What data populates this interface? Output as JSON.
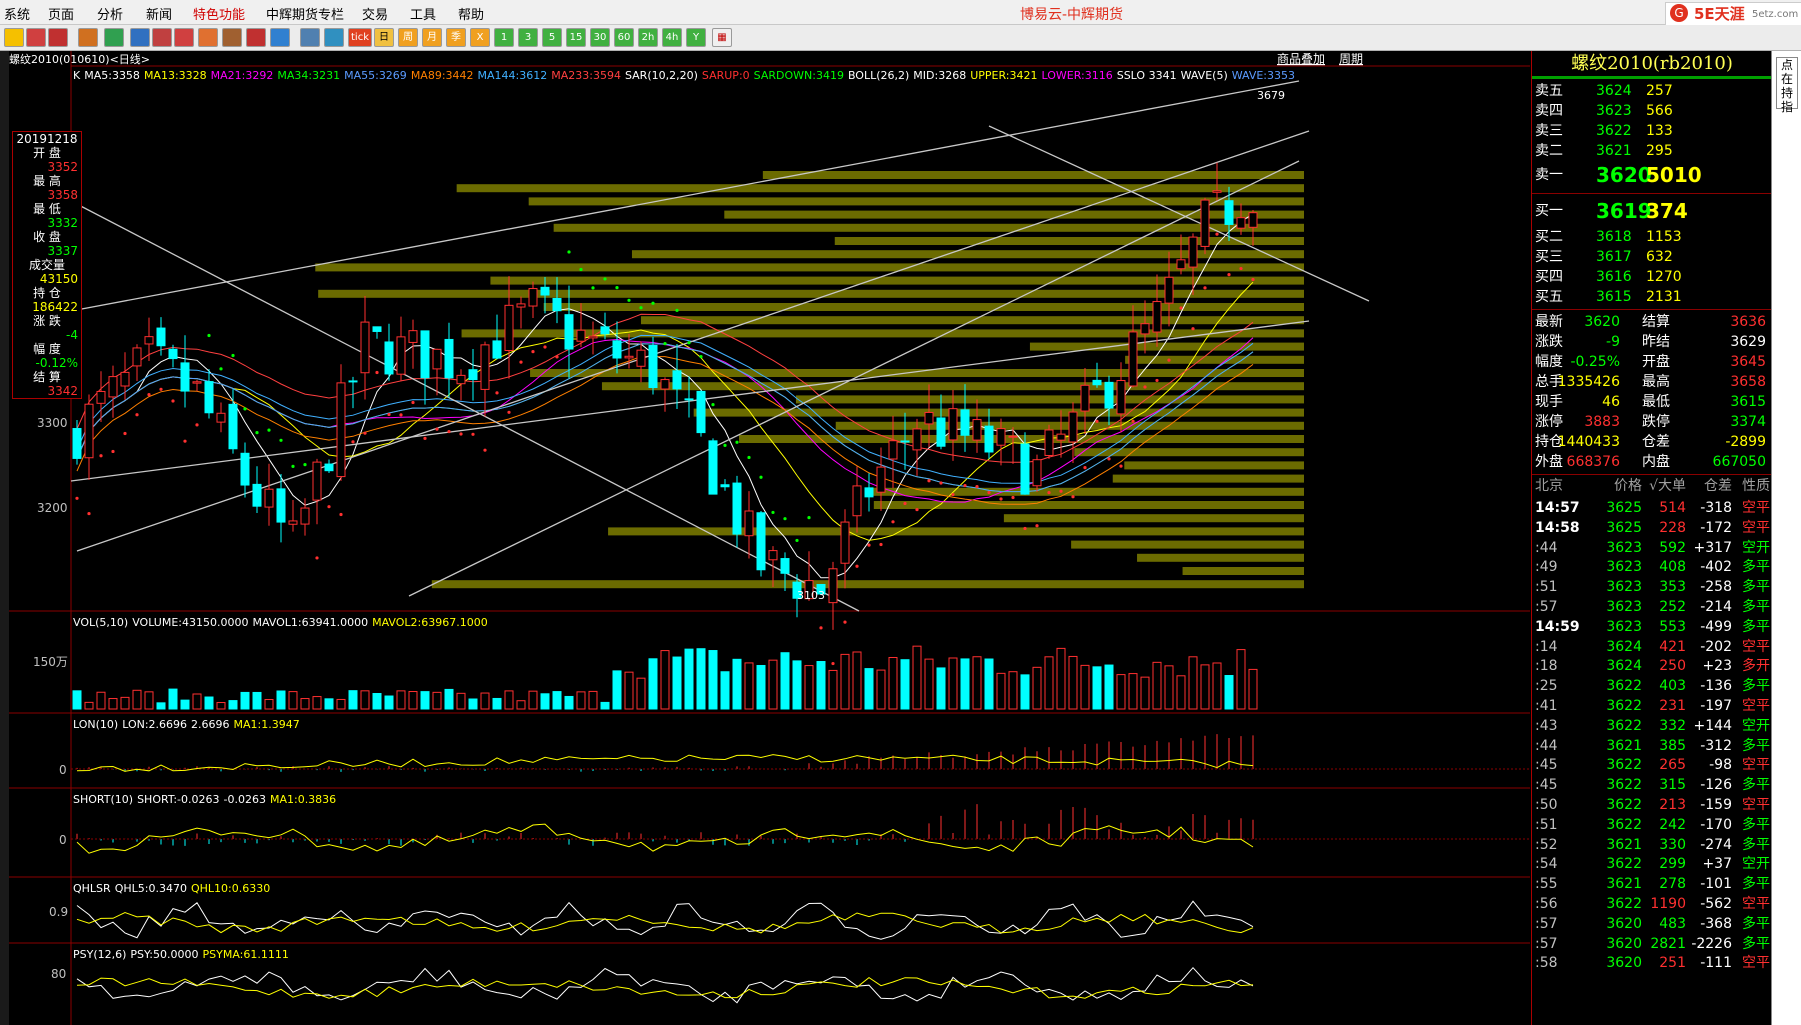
{
  "app_title": "博易云-中辉期货",
  "brand": {
    "logo_text": "5E天涯",
    "site": "5etz.com"
  },
  "menu": [
    "系统",
    "页面",
    "分析",
    "新闻",
    "特色功能",
    "中辉期货专栏",
    "交易",
    "工具",
    "帮助"
  ],
  "toolbar_buttons": [
    "tick",
    "日",
    "周",
    "月",
    "季",
    "X",
    "1",
    "3",
    "5",
    "15",
    "30",
    "60",
    "2h",
    "4h",
    "Y"
  ],
  "chart_header": {
    "symbol_label": "螺纹2010(010610)<日线>",
    "link_product": "商品叠加",
    "link_period": "周期"
  },
  "indicators_main": [
    {
      "text": "K",
      "color": "#ffffff"
    },
    {
      "text": "MA5:3358",
      "color": "#ffffff"
    },
    {
      "text": "MA13:3328",
      "color": "#ffff00"
    },
    {
      "text": "MA21:3292",
      "color": "#ff00ff"
    },
    {
      "text": "MA34:3231",
      "color": "#00ff00"
    },
    {
      "text": "MA55:3269",
      "color": "#5b9bff"
    },
    {
      "text": "MA89:3442",
      "color": "#ff8000"
    },
    {
      "text": "MA144:3612",
      "color": "#40b0ff"
    },
    {
      "text": "MA233:3594",
      "color": "#ff4040"
    },
    {
      "text": "SAR(10,2,20)",
      "color": "#ffffff"
    },
    {
      "text": "SARUP:0",
      "color": "#ff3030"
    },
    {
      "text": "SARDOWN:3419",
      "color": "#00ff00"
    },
    {
      "text": "BOLL(26,2)",
      "color": "#ffffff"
    },
    {
      "text": "MID:3268",
      "color": "#ffffff"
    },
    {
      "text": "UPPER:3421",
      "color": "#ffff00"
    },
    {
      "text": "LOWER:3116",
      "color": "#ff00ff"
    },
    {
      "text": "SSLO 3341",
      "color": "#ffffff"
    },
    {
      "text": "WAVE(5)",
      "color": "#ffffff"
    },
    {
      "text": "WAVE:3353",
      "color": "#5b9bff"
    }
  ],
  "info_box": [
    {
      "label": "20191218",
      "value": ""
    },
    {
      "label": "开 盘",
      "value": "3352",
      "color": "#ff3030"
    },
    {
      "label": "最 高",
      "value": "3358",
      "color": "#ff3030"
    },
    {
      "label": "最 低",
      "value": "3332",
      "color": "#00ff00"
    },
    {
      "label": "收 盘",
      "value": "3337",
      "color": "#00ff00"
    },
    {
      "label": "成交量",
      "value": "43150",
      "color": "#ffff00"
    },
    {
      "label": "持 仓",
      "value": "186422",
      "color": "#ffff00"
    },
    {
      "label": "涨 跌",
      "value": "-4",
      "color": "#00ff00"
    },
    {
      "label": "幅 度",
      "value": "-0.12%",
      "color": "#00ff00"
    },
    {
      "label": "结 算",
      "value": "3342",
      "color": "#ff3030"
    }
  ],
  "price_axis_labels": [
    "3300",
    "3200"
  ],
  "price_annotations": {
    "high": "3679",
    "low": "3103"
  },
  "sub_panels": [
    {
      "header": [
        {
          "t": "VOL(5,10)",
          "c": "#ffffff"
        },
        {
          "t": "VOLUME:43150.0000",
          "c": "#ffffff"
        },
        {
          "t": "MAVOL1:63941.0000",
          "c": "#ffffff"
        },
        {
          "t": "MAVOL2:63967.1000",
          "c": "#ffff00"
        }
      ],
      "axis": "150万"
    },
    {
      "header": [
        {
          "t": "LON(10)",
          "c": "#ffffff"
        },
        {
          "t": "LON:2.6696",
          "c": "#ffffff"
        },
        {
          "t": "2.6696",
          "c": "#ffffff"
        },
        {
          "t": "MA1:1.3947",
          "c": "#ffff00"
        }
      ],
      "axis": "0"
    },
    {
      "header": [
        {
          "t": "SHORT(10)",
          "c": "#ffffff"
        },
        {
          "t": "SHORT:-0.0263",
          "c": "#ffffff"
        },
        {
          "t": "-0.0263",
          "c": "#ffffff"
        },
        {
          "t": "MA1:0.3836",
          "c": "#ffff00"
        }
      ],
      "axis": "0"
    },
    {
      "header": [
        {
          "t": "QHLSR",
          "c": "#ffffff"
        },
        {
          "t": "QHL5:0.3470",
          "c": "#ffffff"
        },
        {
          "t": "QHL10:0.6330",
          "c": "#ffff00"
        }
      ],
      "axis": "0.9"
    },
    {
      "header": [
        {
          "t": "PSY(12,6)",
          "c": "#ffffff"
        },
        {
          "t": "PSY:50.0000",
          "c": "#ffffff"
        },
        {
          "t": "PSYMA:61.1111",
          "c": "#ffff00"
        }
      ],
      "axis": "80"
    }
  ],
  "quote": {
    "title": "螺纹2010(rb2010)",
    "asks": [
      {
        "label": "卖五",
        "price": "3624",
        "vol": "257"
      },
      {
        "label": "卖四",
        "price": "3623",
        "vol": "566"
      },
      {
        "label": "卖三",
        "price": "3622",
        "vol": "133"
      },
      {
        "label": "卖二",
        "price": "3621",
        "vol": "295"
      },
      {
        "label": "卖一",
        "price": "3620",
        "vol": "5010"
      }
    ],
    "bids": [
      {
        "label": "买一",
        "price": "3619",
        "vol": "374"
      },
      {
        "label": "买二",
        "price": "3618",
        "vol": "1153"
      },
      {
        "label": "买三",
        "price": "3617",
        "vol": "632"
      },
      {
        "label": "买四",
        "price": "3616",
        "vol": "1270"
      },
      {
        "label": "买五",
        "price": "3615",
        "vol": "2131"
      }
    ],
    "stats": [
      {
        "l1": "最新",
        "v1": "3620",
        "c1": "#00ff00",
        "l2": "结算",
        "v2": "3636",
        "c2": "#ff3030"
      },
      {
        "l1": "涨跌",
        "v1": "-9",
        "c1": "#00ff00",
        "l2": "昨结",
        "v2": "3629",
        "c2": "#ffffff"
      },
      {
        "l1": "幅度",
        "v1": "-0.25%",
        "c1": "#00ff00",
        "l2": "开盘",
        "v2": "3645",
        "c2": "#ff3030"
      },
      {
        "l1": "总手",
        "v1": "1335426",
        "c1": "#ffff00",
        "l2": "最高",
        "v2": "3658",
        "c2": "#ff3030"
      },
      {
        "l1": "现手",
        "v1": "46",
        "c1": "#ffff00",
        "l2": "最低",
        "v2": "3615",
        "c2": "#00ff00"
      },
      {
        "l1": "涨停",
        "v1": "3883",
        "c1": "#ff3030",
        "l2": "跌停",
        "v2": "3374",
        "c2": "#00ff00"
      },
      {
        "l1": "持仓",
        "v1": "1440433",
        "c1": "#ffff00",
        "l2": "仓差",
        "v2": "-2899",
        "c2": "#ffff00"
      },
      {
        "l1": "外盘",
        "v1": "668376",
        "c1": "#ff3030",
        "l2": "内盘",
        "v2": "667050",
        "c2": "#00ff00"
      }
    ],
    "tick_header": [
      "北京",
      "价格",
      "√大单",
      "仓差",
      "性质"
    ],
    "ticks": [
      {
        "time": "14:57",
        "price": "3625",
        "vol": "514",
        "diff": "-318",
        "nature": "空平",
        "tc": "#ffffff",
        "vc": "#ff3030",
        "nc": "#ff3030"
      },
      {
        "time": "14:58",
        "price": "3625",
        "vol": "228",
        "diff": "-172",
        "nature": "空平",
        "tc": "#ffffff",
        "vc": "#ff3030",
        "nc": "#ff3030"
      },
      {
        "time": ":44",
        "price": "3623",
        "vol": "592",
        "diff": "+317",
        "nature": "空开",
        "tc": "#c0c0c0",
        "vc": "#00ff00",
        "nc": "#00ff00"
      },
      {
        "time": ":49",
        "price": "3623",
        "vol": "408",
        "diff": "-402",
        "nature": "多平",
        "tc": "#c0c0c0",
        "vc": "#00ff00",
        "nc": "#00ff00"
      },
      {
        "time": ":51",
        "price": "3623",
        "vol": "353",
        "diff": "-258",
        "nature": "多平",
        "tc": "#c0c0c0",
        "vc": "#00ff00",
        "nc": "#00ff00"
      },
      {
        "time": ":57",
        "price": "3623",
        "vol": "252",
        "diff": "-214",
        "nature": "多平",
        "tc": "#c0c0c0",
        "vc": "#00ff00",
        "nc": "#00ff00"
      },
      {
        "time": "14:59",
        "price": "3623",
        "vol": "553",
        "diff": "-499",
        "nature": "多平",
        "tc": "#ffffff",
        "vc": "#00ff00",
        "nc": "#00ff00"
      },
      {
        "time": ":14",
        "price": "3624",
        "vol": "421",
        "diff": "-202",
        "nature": "空平",
        "tc": "#c0c0c0",
        "vc": "#ff3030",
        "nc": "#ff3030"
      },
      {
        "time": ":18",
        "price": "3624",
        "vol": "250",
        "diff": "+23",
        "nature": "多开",
        "tc": "#c0c0c0",
        "vc": "#ff3030",
        "nc": "#ff3030"
      },
      {
        "time": ":25",
        "price": "3622",
        "vol": "403",
        "diff": "-136",
        "nature": "多平",
        "tc": "#c0c0c0",
        "vc": "#00ff00",
        "nc": "#00ff00"
      },
      {
        "time": ":41",
        "price": "3622",
        "vol": "231",
        "diff": "-197",
        "nature": "空平",
        "tc": "#c0c0c0",
        "vc": "#ff3030",
        "nc": "#ff3030"
      },
      {
        "time": ":43",
        "price": "3622",
        "vol": "332",
        "diff": "+144",
        "nature": "空开",
        "tc": "#c0c0c0",
        "vc": "#00ff00",
        "nc": "#00ff00"
      },
      {
        "time": ":44",
        "price": "3621",
        "vol": "385",
        "diff": "-312",
        "nature": "多平",
        "tc": "#c0c0c0",
        "vc": "#00ff00",
        "nc": "#00ff00"
      },
      {
        "time": ":45",
        "price": "3622",
        "vol": "265",
        "diff": "-98",
        "nature": "空平",
        "tc": "#c0c0c0",
        "vc": "#ff3030",
        "nc": "#ff3030"
      },
      {
        "time": ":45",
        "price": "3622",
        "vol": "315",
        "diff": "-126",
        "nature": "多平",
        "tc": "#c0c0c0",
        "vc": "#00ff00",
        "nc": "#00ff00"
      },
      {
        "time": ":50",
        "price": "3622",
        "vol": "213",
        "diff": "-159",
        "nature": "空平",
        "tc": "#c0c0c0",
        "vc": "#ff3030",
        "nc": "#ff3030"
      },
      {
        "time": ":51",
        "price": "3622",
        "vol": "242",
        "diff": "-170",
        "nature": "多平",
        "tc": "#c0c0c0",
        "vc": "#00ff00",
        "nc": "#00ff00"
      },
      {
        "time": ":52",
        "price": "3621",
        "vol": "330",
        "diff": "-274",
        "nature": "多平",
        "tc": "#c0c0c0",
        "vc": "#00ff00",
        "nc": "#00ff00"
      },
      {
        "time": ":54",
        "price": "3622",
        "vol": "299",
        "diff": "+37",
        "nature": "空开",
        "tc": "#c0c0c0",
        "vc": "#00ff00",
        "nc": "#00ff00"
      },
      {
        "time": ":55",
        "price": "3621",
        "vol": "278",
        "diff": "-101",
        "nature": "多平",
        "tc": "#c0c0c0",
        "vc": "#00ff00",
        "nc": "#00ff00"
      },
      {
        "time": ":56",
        "price": "3622",
        "vol": "1190",
        "diff": "-562",
        "nature": "空平",
        "tc": "#c0c0c0",
        "vc": "#ff3030",
        "nc": "#ff3030"
      },
      {
        "time": ":57",
        "price": "3620",
        "vol": "483",
        "diff": "-368",
        "nature": "多平",
        "tc": "#c0c0c0",
        "vc": "#00ff00",
        "nc": "#00ff00"
      },
      {
        "time": ":57",
        "price": "3620",
        "vol": "2821",
        "diff": "-2226",
        "nature": "多平",
        "tc": "#c0c0c0",
        "vc": "#00ff00",
        "nc": "#00ff00"
      },
      {
        "time": ":58",
        "price": "3620",
        "vol": "251",
        "diff": "-111",
        "nature": "空平",
        "tc": "#c0c0c0",
        "vc": "#ff3030",
        "nc": "#ff3030"
      }
    ]
  },
  "side_tab": "点在持指",
  "colors": {
    "up": "#ff3030",
    "down": "#00ffff",
    "bg": "#000000",
    "grid": "#8a0000",
    "volume_profile": "#6b6b00",
    "label_yellow": "#ffff54"
  }
}
